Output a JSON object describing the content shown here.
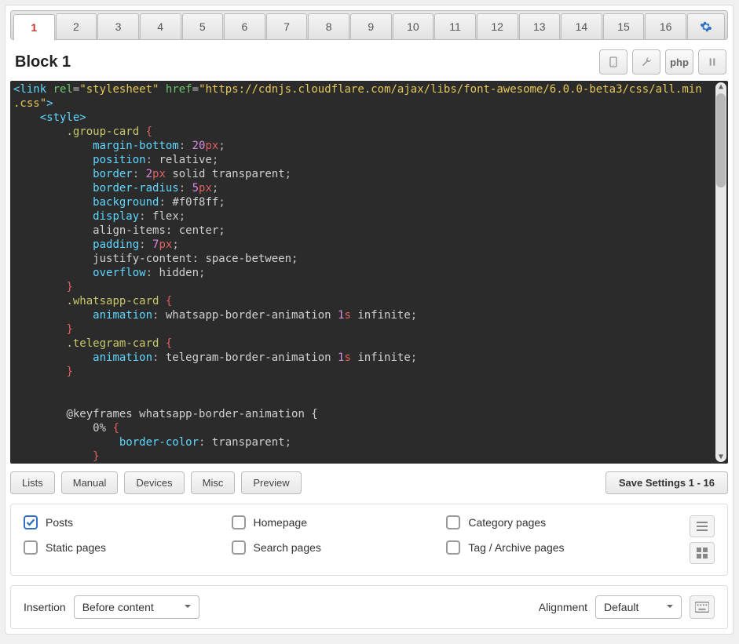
{
  "tabs": {
    "items": [
      "1",
      "2",
      "3",
      "4",
      "5",
      "6",
      "7",
      "8",
      "9",
      "10",
      "11",
      "12",
      "13",
      "14",
      "15",
      "16"
    ],
    "active": 0
  },
  "header": {
    "title": "Block 1",
    "phpLabel": "php"
  },
  "code_lines": [
    [
      [
        "tag",
        "<link "
      ],
      [
        "attr",
        "rel"
      ],
      [
        "punc",
        "="
      ],
      [
        "str",
        "\"stylesheet\""
      ],
      [
        "attr",
        " href"
      ],
      [
        "punc",
        "="
      ],
      [
        "str",
        "\"https://cdnjs.cloudflare.com/ajax/libs/font-awesome/6.0.0-beta3/css/all.min"
      ]
    ],
    [
      [
        "str",
        ".css\""
      ],
      [
        "tag",
        ">"
      ]
    ],
    [
      [
        "indent",
        1
      ],
      [
        "tag",
        "<style>"
      ]
    ],
    [
      [
        "indent",
        2
      ],
      [
        "sel",
        ".group-card "
      ],
      [
        "brace",
        "{"
      ]
    ],
    [
      [
        "indent",
        3
      ],
      [
        "prop",
        "margin-bottom"
      ],
      [
        "punc",
        ": "
      ],
      [
        "num",
        "20"
      ],
      [
        "brace",
        "px"
      ],
      [
        "punc",
        ";"
      ]
    ],
    [
      [
        "indent",
        3
      ],
      [
        "prop",
        "position"
      ],
      [
        "punc",
        ": "
      ],
      [
        "val",
        "relative"
      ],
      [
        "punc",
        ";"
      ]
    ],
    [
      [
        "indent",
        3
      ],
      [
        "prop",
        "border"
      ],
      [
        "punc",
        ": "
      ],
      [
        "num",
        "2"
      ],
      [
        "brace",
        "px "
      ],
      [
        "val",
        "solid transparent"
      ],
      [
        "punc",
        ";"
      ]
    ],
    [
      [
        "indent",
        3
      ],
      [
        "prop",
        "border-radius"
      ],
      [
        "punc",
        ": "
      ],
      [
        "num",
        "5"
      ],
      [
        "brace",
        "px"
      ],
      [
        "punc",
        ";"
      ]
    ],
    [
      [
        "indent",
        3
      ],
      [
        "prop",
        "background"
      ],
      [
        "punc",
        ": "
      ],
      [
        "val",
        "#f0f8ff"
      ],
      [
        "punc",
        ";"
      ]
    ],
    [
      [
        "indent",
        3
      ],
      [
        "prop",
        "display"
      ],
      [
        "punc",
        ": "
      ],
      [
        "val",
        "flex"
      ],
      [
        "punc",
        ";"
      ]
    ],
    [
      [
        "indent",
        3
      ],
      [
        "white",
        "align-items: center;"
      ]
    ],
    [
      [
        "indent",
        3
      ],
      [
        "prop",
        "padding"
      ],
      [
        "punc",
        ": "
      ],
      [
        "num",
        "7"
      ],
      [
        "brace",
        "px"
      ],
      [
        "punc",
        ";"
      ]
    ],
    [
      [
        "indent",
        3
      ],
      [
        "white",
        "justify-content: space-between;"
      ]
    ],
    [
      [
        "indent",
        3
      ],
      [
        "prop",
        "overflow"
      ],
      [
        "punc",
        ": "
      ],
      [
        "val",
        "hidden"
      ],
      [
        "punc",
        ";"
      ]
    ],
    [
      [
        "indent",
        2
      ],
      [
        "brace",
        "}"
      ]
    ],
    [
      [
        "indent",
        2
      ],
      [
        "sel",
        ".whatsapp-card "
      ],
      [
        "brace",
        "{"
      ]
    ],
    [
      [
        "indent",
        3
      ],
      [
        "prop",
        "animation"
      ],
      [
        "punc",
        ": "
      ],
      [
        "white",
        "whatsapp-border-animation "
      ],
      [
        "num",
        "1"
      ],
      [
        "brace",
        "s "
      ],
      [
        "white",
        "infinite"
      ],
      [
        "punc",
        ";"
      ]
    ],
    [
      [
        "indent",
        2
      ],
      [
        "brace",
        "}"
      ]
    ],
    [
      [
        "indent",
        2
      ],
      [
        "sel",
        ".telegram-card "
      ],
      [
        "brace",
        "{"
      ]
    ],
    [
      [
        "indent",
        3
      ],
      [
        "prop",
        "animation"
      ],
      [
        "punc",
        ": "
      ],
      [
        "white",
        "telegram-border-animation "
      ],
      [
        "num",
        "1"
      ],
      [
        "brace",
        "s "
      ],
      [
        "white",
        "infinite"
      ],
      [
        "punc",
        ";"
      ]
    ],
    [
      [
        "indent",
        2
      ],
      [
        "brace",
        "}"
      ]
    ],
    [
      [
        "indent",
        0
      ],
      [
        "white",
        " "
      ]
    ],
    [
      [
        "indent",
        0
      ],
      [
        "white",
        " "
      ]
    ],
    [
      [
        "indent",
        2
      ],
      [
        "white",
        "@keyframes whatsapp-border-animation {"
      ]
    ],
    [
      [
        "indent",
        3
      ],
      [
        "white",
        "0% "
      ],
      [
        "brace",
        "{"
      ]
    ],
    [
      [
        "indent",
        4
      ],
      [
        "prop",
        "border-color"
      ],
      [
        "punc",
        ": "
      ],
      [
        "val",
        "transparent"
      ],
      [
        "punc",
        ";"
      ]
    ],
    [
      [
        "indent",
        3
      ],
      [
        "brace",
        "}"
      ]
    ]
  ],
  "buttons": {
    "lists": "Lists",
    "manual": "Manual",
    "devices": "Devices",
    "misc": "Misc",
    "preview": "Preview",
    "save": "Save Settings 1 - 16"
  },
  "checkboxes": {
    "posts": {
      "label": "Posts",
      "checked": true
    },
    "static": {
      "label": "Static pages",
      "checked": false
    },
    "home": {
      "label": "Homepage",
      "checked": false
    },
    "search": {
      "label": "Search pages",
      "checked": false
    },
    "category": {
      "label": "Category pages",
      "checked": false
    },
    "tag": {
      "label": "Tag / Archive pages",
      "checked": false
    }
  },
  "insertion": {
    "label": "Insertion",
    "value": "Before content"
  },
  "alignment": {
    "label": "Alignment",
    "value": "Default"
  }
}
